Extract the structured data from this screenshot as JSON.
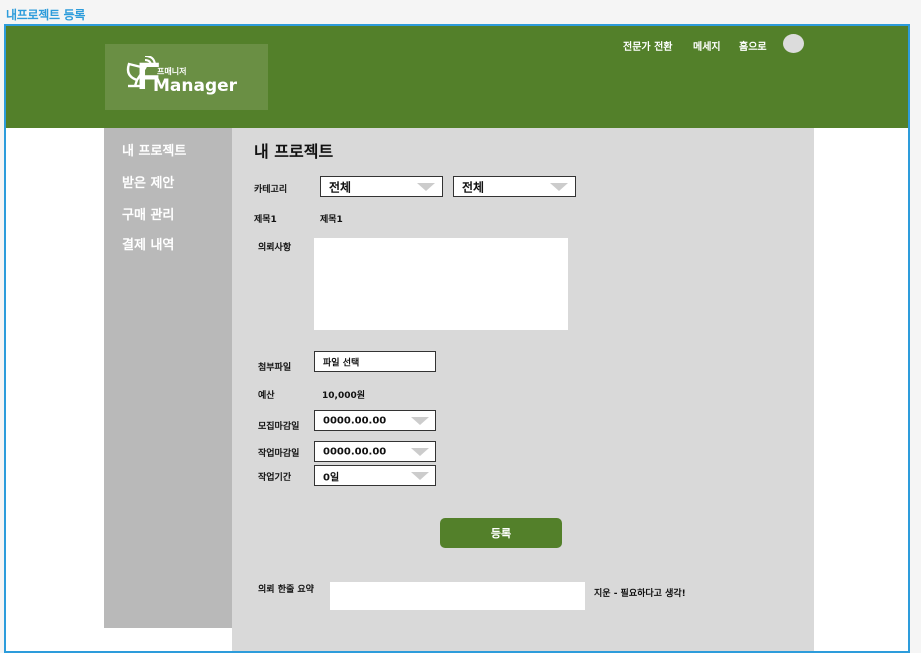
{
  "page": {
    "frame_title": "내프로젝트 등록"
  },
  "header": {
    "logo": {
      "small": "프매니저",
      "big_letter": "F",
      "word": "Manager"
    },
    "nav": [
      "전문가 전환",
      "메세지",
      "홈으로"
    ]
  },
  "sidebar": {
    "items": [
      "내 프로젝트",
      "받은 제안",
      "구매 관리",
      "결제 내역"
    ]
  },
  "form": {
    "title": "내 프로젝트",
    "category_label": "카테고리",
    "category_value_1": "전체",
    "category_value_2": "전체",
    "subject_label": "제목1",
    "subject_value": "제목1",
    "request_label": "의뢰사항",
    "attachment_label": "첨부파일",
    "attachment_button": "파일 선택",
    "budget_label": "예산",
    "budget_value": "10,000원",
    "recruit_deadline_label": "모집마감일",
    "recruit_deadline_value": "0000.00.00",
    "work_deadline_label": "작업마감일",
    "work_deadline_value": "0000.00.00",
    "work_period_label": "작업기간",
    "work_period_value": "0일",
    "submit_label": "등록",
    "summary_label": "의뢰 한줄 요약",
    "summary_note": "지운 - 필요하다고 생각!"
  },
  "colors": {
    "header": "#53802a",
    "accent": "#2d9cdb",
    "sidebar": "#b9b9b9",
    "content": "#d9d9d9"
  }
}
